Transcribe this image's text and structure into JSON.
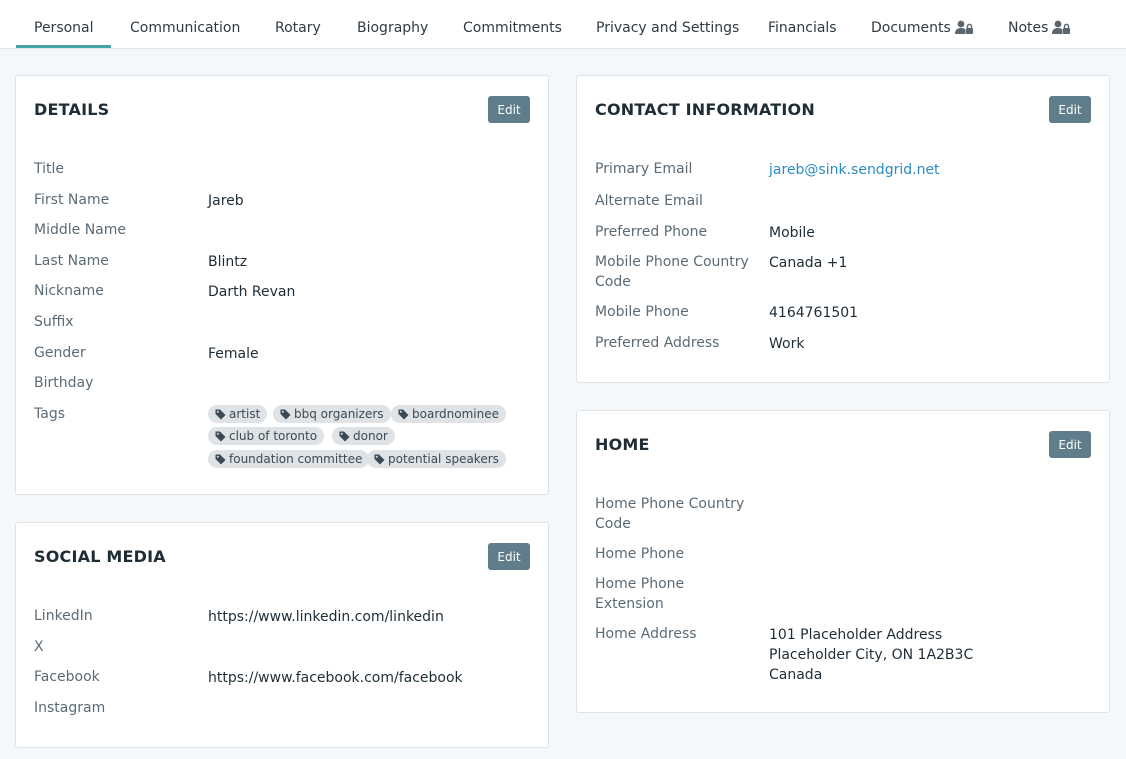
{
  "tabs": [
    {
      "label": "Personal"
    },
    {
      "label": "Communication"
    },
    {
      "label": "Rotary"
    },
    {
      "label": "Biography"
    },
    {
      "label": "Commitments"
    },
    {
      "label": "Privacy and Settings"
    },
    {
      "label": "Financials"
    },
    {
      "label": "Documents"
    },
    {
      "label": "Notes"
    }
  ],
  "details": {
    "title": "DETAILS",
    "edit_label": "Edit",
    "fields": {
      "title": {
        "label": "Title",
        "value": ""
      },
      "first_name": {
        "label": "First Name",
        "value": "Jareb"
      },
      "middle_name": {
        "label": "Middle Name",
        "value": ""
      },
      "last_name": {
        "label": "Last Name",
        "value": "Blintz"
      },
      "nickname": {
        "label": "Nickname",
        "value": "Darth Revan"
      },
      "suffix": {
        "label": "Suffix",
        "value": ""
      },
      "gender": {
        "label": "Gender",
        "value": "Female"
      },
      "birthday": {
        "label": "Birthday",
        "value": ""
      },
      "tags": {
        "label": "Tags"
      }
    },
    "tags": [
      "artist",
      "bbq organizers",
      "boardnominee",
      "club of toronto",
      "donor",
      "foundation committee",
      "potential speakers"
    ]
  },
  "social": {
    "title": "SOCIAL MEDIA",
    "edit_label": "Edit",
    "fields": {
      "linkedin": {
        "label": "LinkedIn",
        "value": "https://www.linkedin.com/linkedin"
      },
      "x": {
        "label": "X",
        "value": ""
      },
      "facebook": {
        "label": "Facebook",
        "value": "https://www.facebook.com/facebook"
      },
      "instagram": {
        "label": "Instagram",
        "value": ""
      }
    }
  },
  "contact": {
    "title": "CONTACT INFORMATION",
    "edit_label": "Edit",
    "fields": {
      "primary_email": {
        "label": "Primary Email",
        "value": "jareb@sink.sendgrid.net"
      },
      "alternate_email": {
        "label": "Alternate Email",
        "value": ""
      },
      "preferred_phone": {
        "label": "Preferred Phone",
        "value": "Mobile"
      },
      "mobile_country_code": {
        "label_line1": "Mobile Phone Country",
        "label_line2": "Code",
        "value": "Canada +1"
      },
      "mobile_phone": {
        "label": "Mobile Phone",
        "value": "4164761501"
      },
      "preferred_address": {
        "label": "Preferred Address",
        "value": "Work"
      }
    }
  },
  "home": {
    "title": "HOME",
    "edit_label": "Edit",
    "fields": {
      "home_country_code": {
        "label_line1": "Home Phone Country",
        "label_line2": "Code",
        "value": ""
      },
      "home_phone": {
        "label": "Home Phone",
        "value": ""
      },
      "home_extension": {
        "label_line1": "Home Phone",
        "label_line2": "Extension",
        "value": ""
      },
      "home_address": {
        "label": "Home Address",
        "line1": "101 Placeholder Address",
        "line2": "Placeholder City, ON 1A2B3C",
        "line3": "Canada"
      }
    }
  },
  "colors": {
    "accent": "#45a3a3",
    "edit_button": "#607d8b",
    "link": "#2b8cc4",
    "background": "#f5f8fa"
  },
  "icons": {
    "tab_lock": "user-lock-icon",
    "tag": "tag-icon"
  }
}
